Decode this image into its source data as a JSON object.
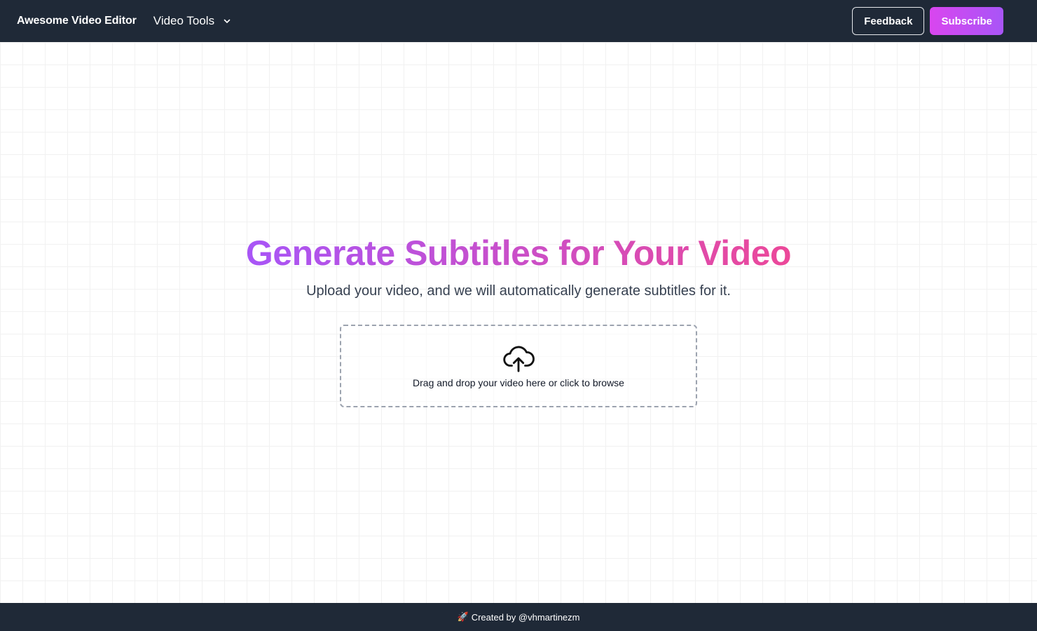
{
  "navbar": {
    "brand": "Awesome Video Editor",
    "menu_label": "Video Tools",
    "feedback_label": "Feedback",
    "subscribe_label": "Subscribe"
  },
  "hero": {
    "title": "Generate Subtitles for Your Video",
    "subtitle": "Upload your video, and we will automatically generate subtitles for it."
  },
  "dropzone": {
    "icon": "cloud-upload-icon",
    "text": "Drag and drop your video here or click to browse"
  },
  "footer": {
    "icon": "rocket-icon",
    "rocket": "🚀",
    "text": "Created by @vhmartinezm"
  },
  "colors": {
    "nav_bg": "#1f2937",
    "accent_start": "#a855f7",
    "accent_end": "#ec4899",
    "subscribe_start": "#d946ef"
  }
}
